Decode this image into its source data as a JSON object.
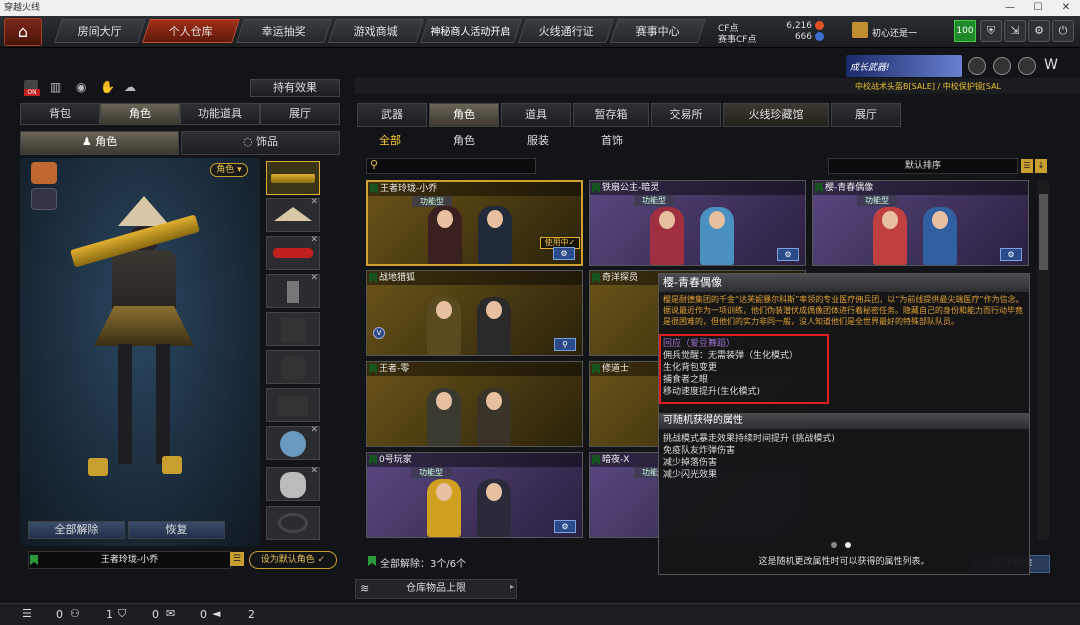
{
  "window": {
    "title": "穿越火线",
    "minimize": "—",
    "maximize": "☐",
    "close": "✕"
  },
  "nav": {
    "tabs": [
      "房间大厅",
      "个人仓库",
      "幸运抽奖",
      "游戏商城",
      "神秘商人活动开启",
      "火线通行证",
      "赛事中心"
    ],
    "active": 1
  },
  "currency": {
    "cf_label": "CF点",
    "cf_value": "6,216",
    "event_label": "赛事CF点",
    "event_value": "666"
  },
  "user": {
    "name": "初心还是一",
    "level": "100"
  },
  "banner": {
    "ad": "成长武器!",
    "ticker": "中校战术头盔B[SALE] / 中校保护镜[SAL"
  },
  "left": {
    "effects_button": "持有效果",
    "on_badge": "ON",
    "tabs": [
      "背包",
      "角色",
      "功能道具",
      "展厅"
    ],
    "active": 1,
    "subtabs": [
      "角色",
      "饰品"
    ],
    "role_dropdown": "角色",
    "unequip_all": "全部解除",
    "restore": "恢复",
    "current_name": "王者玲珑-小乔",
    "set_default": "设为默认角色"
  },
  "right": {
    "tabs": [
      "武器",
      "角色",
      "道具",
      "暂存箱",
      "交易所",
      "火线珍藏馆",
      "展厅"
    ],
    "active": 1,
    "subtabs": [
      "全部",
      "角色",
      "服装",
      "首饰"
    ],
    "sub_active": 0,
    "search_placeholder": "",
    "sort": "默认排序",
    "cards": [
      {
        "name": "王者玲珑-小乔",
        "badge": "功能型",
        "equipped": "使用中✓"
      },
      {
        "name": "铁扇公主-暗灵",
        "badge": "功能型",
        "equipped": ""
      },
      {
        "name": "樱-青春偶像",
        "badge": "功能型",
        "equipped": ""
      },
      {
        "name": "战地猎狐",
        "badge": "",
        "equipped": ""
      },
      {
        "name": "奇洋探员",
        "badge": "",
        "equipped": ""
      },
      {
        "name": "王者-零",
        "badge": "",
        "equipped": ""
      },
      {
        "name": "修道士",
        "badge": "",
        "equipped": ""
      },
      {
        "name": "0号玩家",
        "badge": "功能型",
        "equipped": ""
      },
      {
        "name": "暗夜-X",
        "badge": "功能型",
        "equipped": ""
      }
    ],
    "unequip_summary": "全部解除：3个/6个",
    "storage_limit": "仓库物品上限",
    "partial_button": "选择删除"
  },
  "popup": {
    "title": "樱-青春偶像",
    "desc": "樱是耐德集团的千金“达芙妮暴尔科斯”率领的专业医疗佣兵团，以“为前线提供最尖端医疗”作为信念。据说最近作为一项训练，他们伪装潜伏成偶像团体进行着秘密任务。隐藏自己的身份和能力而行动毕竟是很困难的，但他们的实力非同一般，没人知道他们是全世界最好的特殊部队队员。",
    "attrs": [
      "回应（爱豆舞蹈）",
      "佣兵觉醒：无需装弹（生化模式）",
      "生化背包变更",
      "捕食者之眼",
      "移动速度提升(生化模式)"
    ],
    "random_title": "可随机获得的属性",
    "random_attrs": [
      "挑战模式暴走效果持续时间提升 (挑战模式)",
      "免疫队友炸弹伤害",
      "减少掉落伤害",
      "减少闪光效果"
    ],
    "footer": "这是随机更改属性时可以获得的属性列表。"
  },
  "status": {
    "items": [
      "0",
      "1",
      "0",
      "0",
      "2"
    ]
  }
}
